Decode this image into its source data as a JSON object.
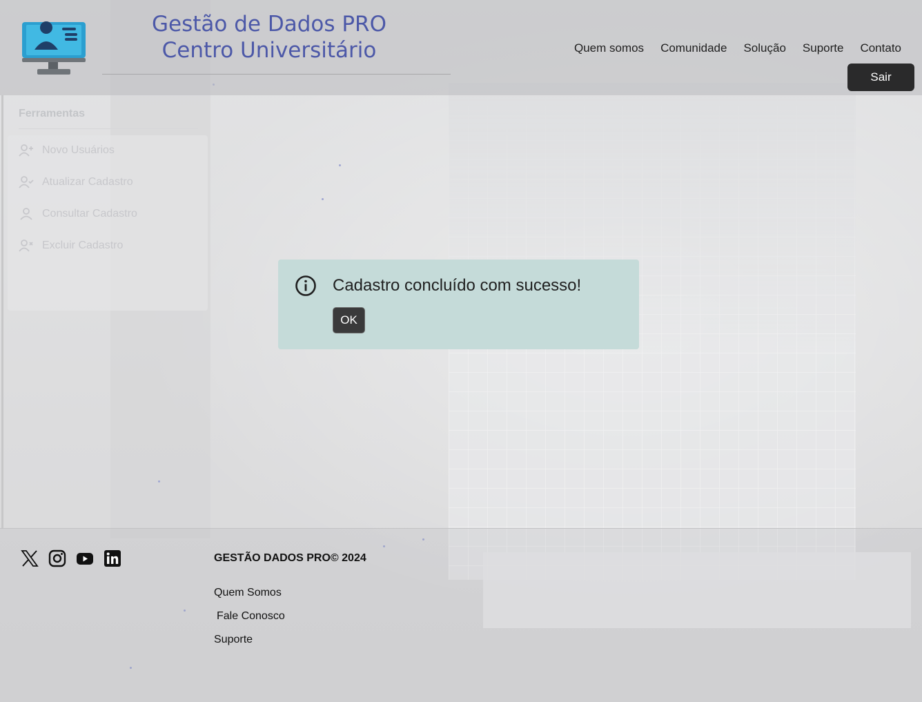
{
  "header": {
    "brand_line1": "Gestão de Dados PRO",
    "brand_line2": "Centro Universitário",
    "logo_icon": "computer-user-icon",
    "nav": [
      "Quem somos",
      "Comunidade",
      "Solução",
      "Suporte",
      "Contato"
    ],
    "logout_label": "Sair"
  },
  "sidebar": {
    "title": "Ferramentas",
    "items": [
      {
        "label": "Novo Usuários",
        "icon": "user-plus-icon"
      },
      {
        "label": "Atualizar Cadastro",
        "icon": "user-check-icon"
      },
      {
        "label": "Consultar Cadastro",
        "icon": "user-icon"
      },
      {
        "label": "Excluir Cadastro",
        "icon": "user-x-icon"
      }
    ]
  },
  "modal": {
    "icon": "info-icon",
    "message": "Cadastro concluído com sucesso!",
    "ok_label": "OK"
  },
  "footer": {
    "social": [
      "x-icon",
      "instagram-icon",
      "youtube-icon",
      "linkedin-icon"
    ],
    "copyright": "GESTÃO DADOS PRO© 2024",
    "links": [
      "Quem Somos",
      "Fale Conosco",
      "Suporte"
    ]
  },
  "colors": {
    "brand": "#4c58a8",
    "modal_bg": "#c5dbd9",
    "button_dark": "#2a2a2b"
  }
}
